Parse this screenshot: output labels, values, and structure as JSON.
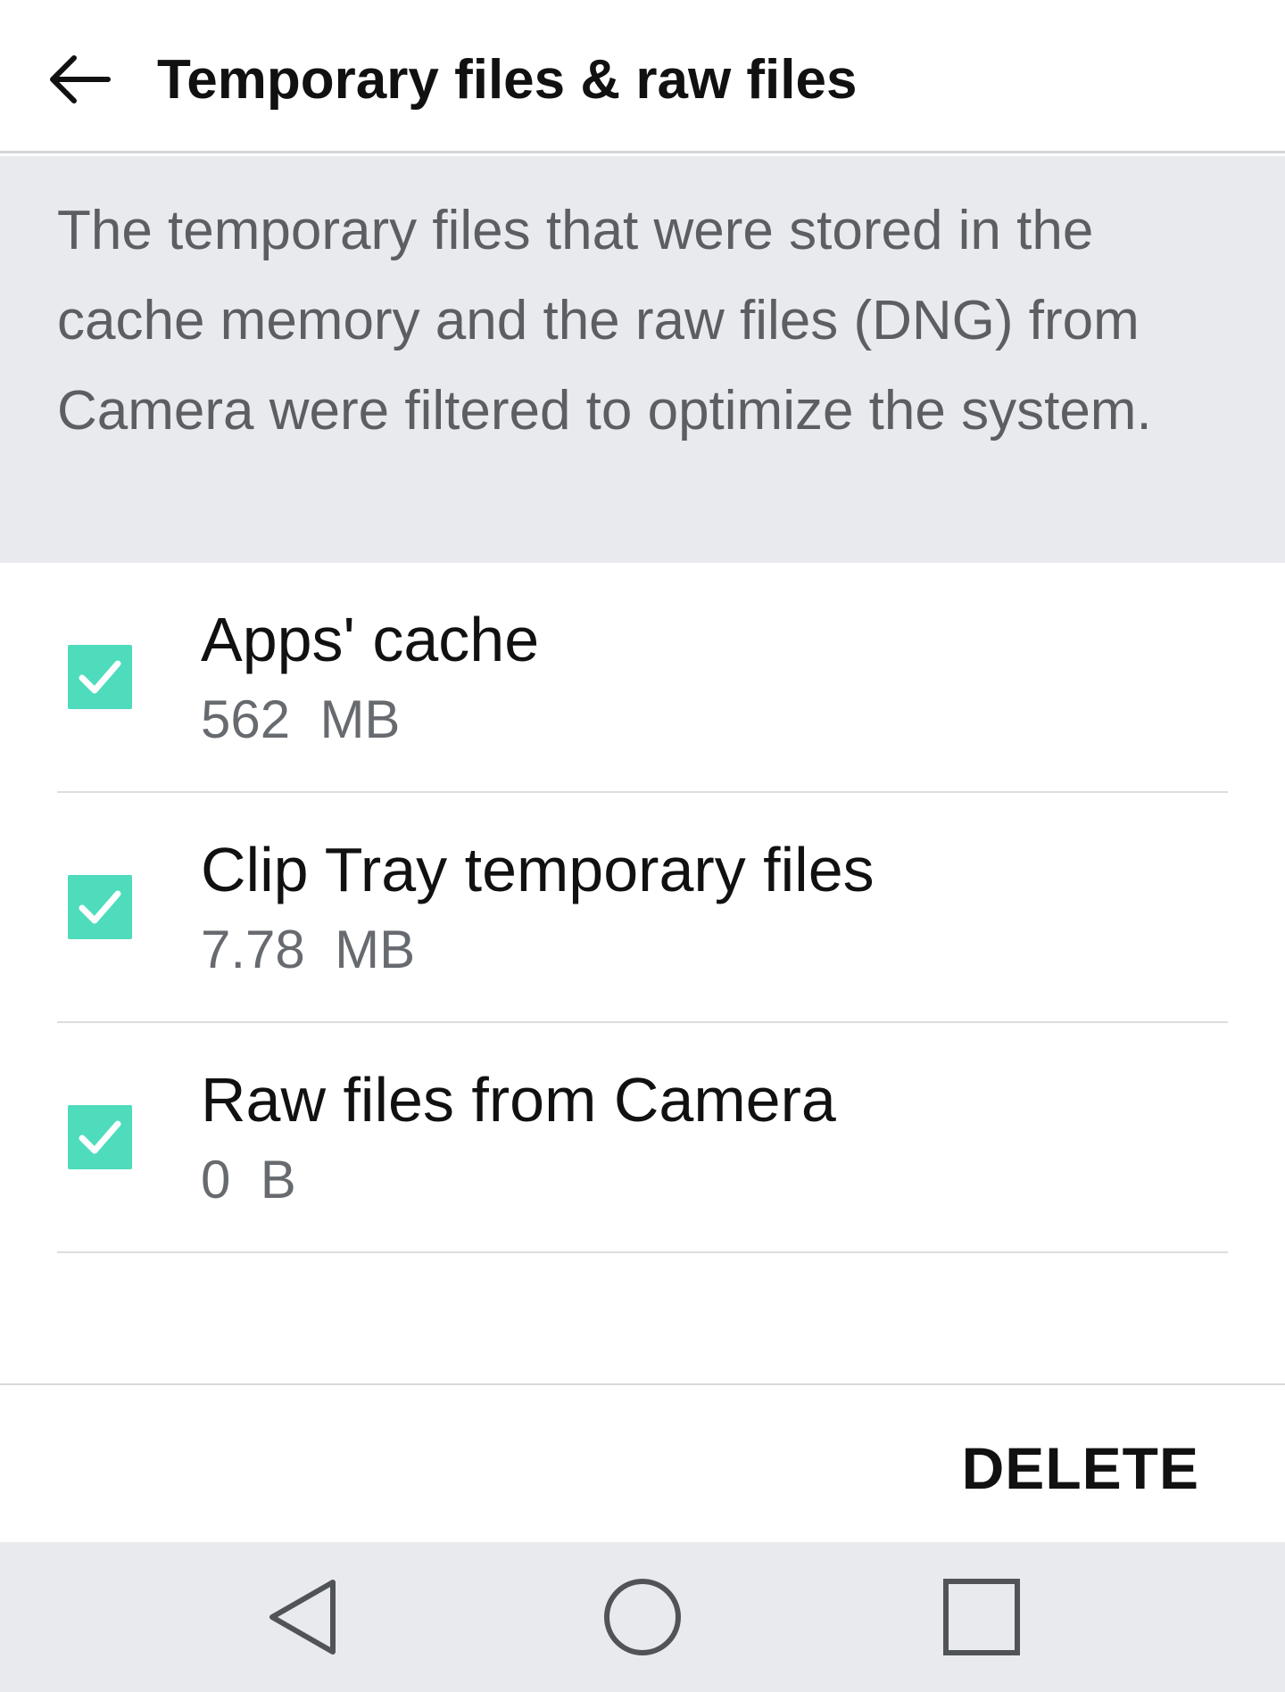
{
  "app_bar": {
    "title": "Temporary files & raw files",
    "back_icon": "arrow-left-icon"
  },
  "info": {
    "text": "The temporary files that were stored in the cache memory and the raw files (DNG) from Camera were filtered to optimize the system."
  },
  "items": [
    {
      "label": "Apps' cache",
      "size": "562  MB",
      "checked": true
    },
    {
      "label": "Clip Tray temporary files",
      "size": "7.78  MB",
      "checked": true
    },
    {
      "label": "Raw files from Camera",
      "size": "0  B",
      "checked": true
    }
  ],
  "footer": {
    "delete_label": "DELETE"
  },
  "nav": {
    "back_icon": "triangle-back-icon",
    "home_icon": "circle-home-icon",
    "recents_icon": "square-recents-icon"
  },
  "colors": {
    "checkbox": "#4edcbd",
    "info_bg": "#e8eaed",
    "nav_bg": "#e9eaed"
  }
}
